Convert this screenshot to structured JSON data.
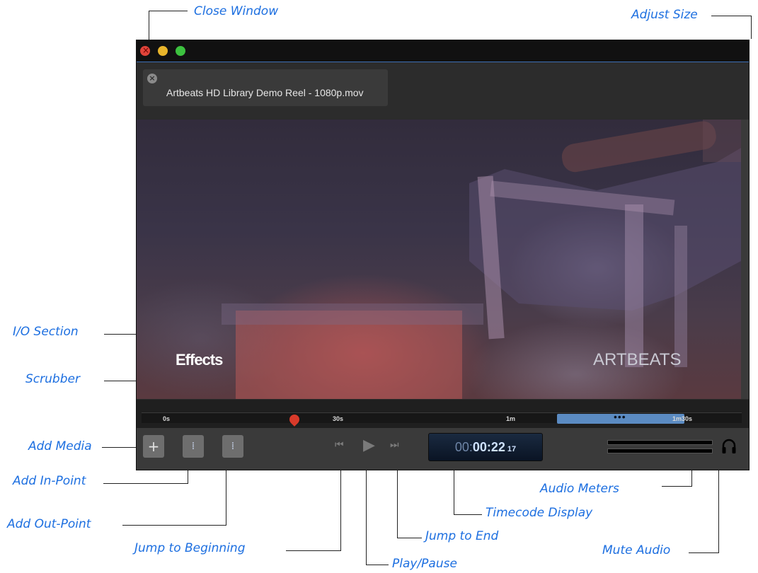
{
  "annotations": {
    "close_window": "Close Window",
    "adjust_size": "Adjust Size",
    "io_section": "I/O Section",
    "scrubber": "Scrubber",
    "add_media": "Add Media",
    "add_in_point": "Add In-Point",
    "add_out_point": "Add Out-Point",
    "jump_to_beginning": "Jump to Beginning",
    "play_pause": "Play/Pause",
    "jump_to_end": "Jump to End",
    "timecode_display": "Timecode Display",
    "audio_meters": "Audio Meters",
    "mute_audio": "Mute Audio"
  },
  "window": {
    "tab_title": "Artbeats HD Library Demo Reel - 1080p.mov"
  },
  "video": {
    "overlay_left": "Effects",
    "overlay_right": "ARTBEATS"
  },
  "timeline": {
    "ticks": [
      "0s",
      "30s",
      "1m",
      "1m30s"
    ],
    "io_dots": "•••"
  },
  "controls": {
    "add_media_glyph": "+",
    "in_point_glyph": "⁞",
    "out_point_glyph": "⁞",
    "jump_begin_glyph": "⏮",
    "play_glyph": "▶",
    "jump_end_glyph": "⏭",
    "timecode_prefix": "00:",
    "timecode_main": "00:22",
    "timecode_frames": "17"
  },
  "colors": {
    "callout": "#1d6fe0",
    "io_section": "#5b8bc2",
    "scrubber": "#d83a2a"
  }
}
